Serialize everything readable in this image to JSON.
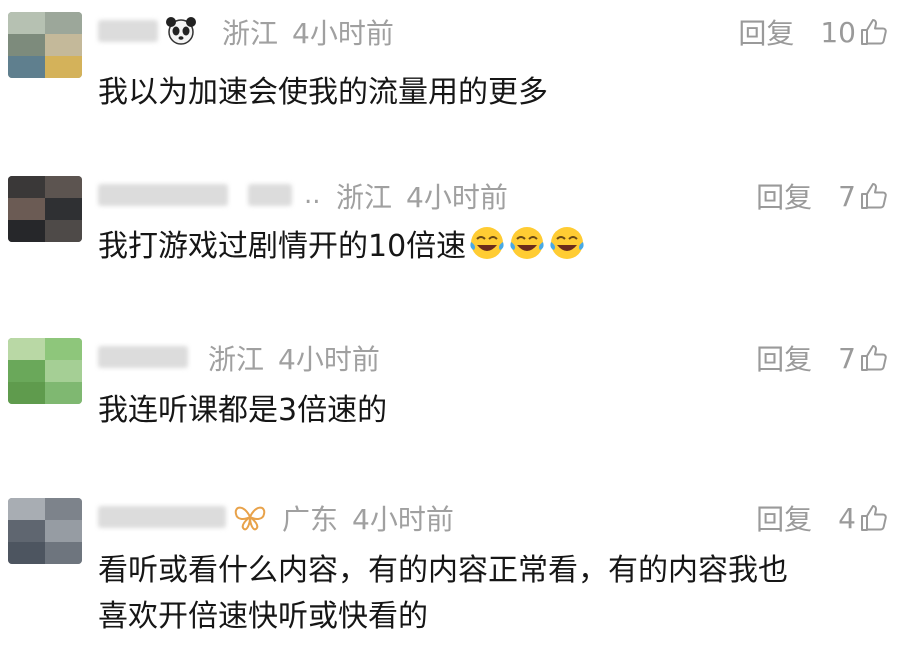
{
  "comments": [
    {
      "location": "浙江",
      "time": "4小时前",
      "reply_label": "回复",
      "likes": "10",
      "text": "我以为加速会使我的流量用的更多",
      "badge": "panda-icon"
    },
    {
      "location": "浙江",
      "time": "4小时前",
      "reply_label": "回复",
      "likes": "7",
      "text": "我打游戏过剧情开的10倍速",
      "emojis": [
        "laugh-cry-emoji",
        "laugh-cry-emoji",
        "laugh-cry-emoji"
      ]
    },
    {
      "location": "浙江",
      "time": "4小时前",
      "reply_label": "回复",
      "likes": "7",
      "text": "我连听课都是3倍速的"
    },
    {
      "location": "广东",
      "time": "4小时前",
      "reply_label": "回复",
      "likes": "4",
      "text": "看听或看什么内容，有的内容正常看，有的内容我也\n喜欢开倍速快听或快看的",
      "badge": "butterfly-icon"
    }
  ],
  "colors": {
    "meta_gray": "#a0a0a0",
    "text": "#161616",
    "badge_orange": "#e8a24a"
  }
}
